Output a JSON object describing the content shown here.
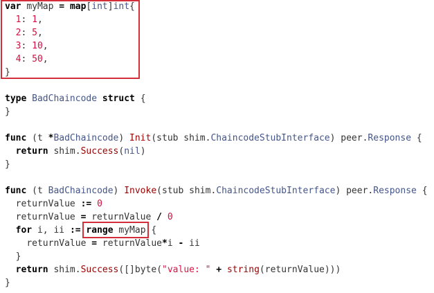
{
  "colors": {
    "keyword": "#000000",
    "type": "#445588",
    "function": "#990000",
    "number": "#d01040",
    "plain": "#333333",
    "highlight_box": "#d32f3a"
  },
  "code": {
    "l1": {
      "kw_var": "var",
      "name": "myMap",
      "op_eq": "=",
      "kw_map": "map",
      "br_open": "[",
      "t1": "int",
      "br_close": "]",
      "t2": "int",
      "brace": "{"
    },
    "l2": {
      "key": "1",
      "colon": ":",
      "val": "1",
      "comma": ","
    },
    "l3": {
      "key": "2",
      "colon": ":",
      "val": "5",
      "comma": ","
    },
    "l4": {
      "key": "3",
      "colon": ":",
      "val": "10",
      "comma": ","
    },
    "l5": {
      "key": "4",
      "colon": ":",
      "val": "50",
      "comma": ","
    },
    "l6": {
      "brace": "}"
    },
    "l7": {
      "kw_type": "type",
      "name": "BadChaincode",
      "kw_struct": "struct",
      "brace": "{"
    },
    "l8": {
      "brace": "}"
    },
    "l9": {
      "kw_func": "func",
      "p_open": "(t ",
      "star": "*",
      "recv": "BadChaincode",
      "p_close": ")",
      "fname": "Init",
      "args_open": "(stub shim.",
      "argtype": "ChaincodeStubInterface",
      "args_close": ") peer.",
      "rettype": "Response",
      "brace": "{"
    },
    "l10": {
      "kw_return": "return",
      "pkg": "shim.",
      "fname": "Success",
      "p_open": "(",
      "nil": "nil",
      "p_close": ")"
    },
    "l11": {
      "brace": "}"
    },
    "l12": {
      "kw_func": "func",
      "p_open": "(t ",
      "recv": "BadChaincode",
      "p_close": ")",
      "fname": "Invoke",
      "args_open": "(stub shim.",
      "argtype": "ChaincodeStubInterface",
      "args_close": ") peer.",
      "rettype": "Response",
      "brace": "{"
    },
    "l13": {
      "var": "returnValue",
      "op": ":=",
      "val": "0"
    },
    "l14": {
      "var": "returnValue",
      "op": "=",
      "var2": "returnValue",
      "op2": "/",
      "val": "0"
    },
    "l15": {
      "kw_for": "for",
      "vars": "i, ii",
      "op": ":=",
      "kw_range": "range",
      "name": "myMap",
      "brace": "{"
    },
    "l16": {
      "var": "returnValue",
      "op": "=",
      "var2": "returnValue",
      "op2": "*",
      "v3": "i",
      "op3": "-",
      "v4": "ii"
    },
    "l17": {
      "brace": "}"
    },
    "l18": {
      "kw_return": "return",
      "pkg": "shim.",
      "fname": "Success",
      "p_open": "([]",
      "kw_byte": "byte",
      "p2": "(",
      "str": "\"value: \"",
      "plus": "+",
      "kw_string": "string",
      "arg": "(returnValue)))"
    },
    "l19": {
      "brace": "}"
    }
  }
}
